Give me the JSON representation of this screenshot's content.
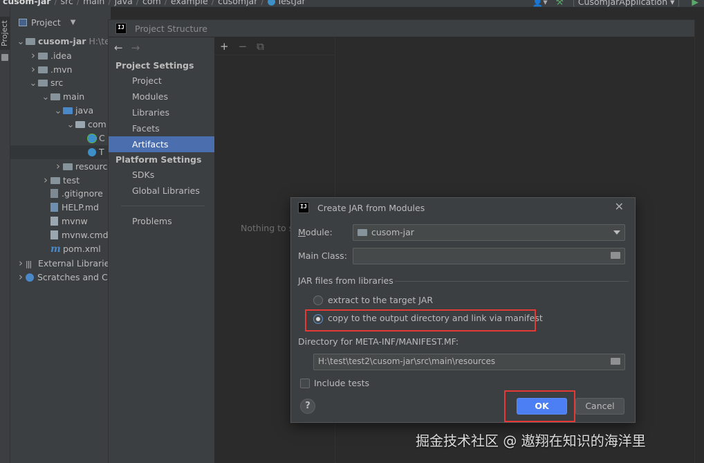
{
  "navbar": {
    "crumbs": [
      "cusom-jar",
      "src",
      "main",
      "java",
      "com",
      "example",
      "cusomjar",
      "TestJar"
    ],
    "run_config": "CusomJarApplication"
  },
  "tool_stripe": {
    "project_tab": "Project"
  },
  "project_panel": {
    "title": "Project",
    "tree": [
      {
        "label": "cusom-jar",
        "extra": "H:\\tes",
        "arrow": "down",
        "indent": 0,
        "icon": "folder",
        "bold": true
      },
      {
        "label": ".idea",
        "arrow": "right",
        "indent": 1,
        "icon": "folder"
      },
      {
        "label": ".mvn",
        "arrow": "right",
        "indent": 1,
        "icon": "folder"
      },
      {
        "label": "src",
        "arrow": "down",
        "indent": 1,
        "icon": "folder"
      },
      {
        "label": "main",
        "arrow": "down",
        "indent": 2,
        "icon": "folder"
      },
      {
        "label": "java",
        "arrow": "down",
        "indent": 3,
        "icon": "folder-blue"
      },
      {
        "label": "com",
        "arrow": "down",
        "indent": 4,
        "icon": "package"
      },
      {
        "label": "C",
        "arrow": "",
        "indent": 5,
        "icon": "class-app"
      },
      {
        "label": "T",
        "arrow": "",
        "indent": 5,
        "icon": "class",
        "highlight": true
      },
      {
        "label": "resources",
        "arrow": "right",
        "indent": 3,
        "icon": "folder"
      },
      {
        "label": "test",
        "arrow": "right",
        "indent": 2,
        "icon": "folder"
      },
      {
        "label": ".gitignore",
        "arrow": "",
        "indent": 2,
        "icon": "file-git"
      },
      {
        "label": "HELP.md",
        "arrow": "",
        "indent": 2,
        "icon": "file-md"
      },
      {
        "label": "mvnw",
        "arrow": "",
        "indent": 2,
        "icon": "file"
      },
      {
        "label": "mvnw.cmd",
        "arrow": "",
        "indent": 2,
        "icon": "file"
      },
      {
        "label": "pom.xml",
        "arrow": "",
        "indent": 2,
        "icon": "maven"
      },
      {
        "label": "External Libraries",
        "arrow": "right",
        "indent": 0,
        "icon": "libs"
      },
      {
        "label": "Scratches and Co",
        "arrow": "right",
        "indent": 0,
        "icon": "scratches"
      }
    ]
  },
  "project_structure": {
    "window_title": "Project Structure",
    "project_settings_header": "Project Settings",
    "project_settings_items": [
      "Project",
      "Modules",
      "Libraries",
      "Facets",
      "Artifacts"
    ],
    "selected_item": "Artifacts",
    "platform_settings_header": "Platform Settings",
    "platform_settings_items": [
      "SDKs",
      "Global Libraries"
    ],
    "problems": "Problems",
    "empty_text": "Nothing to s"
  },
  "dialog": {
    "title": "Create JAR from Modules",
    "module_label": "Module:",
    "module_value": "cusom-jar",
    "main_class_label": "Main Class:",
    "main_class_value": "",
    "jar_section": "JAR files from libraries",
    "option_extract": "extract to the target JAR",
    "option_copy": "copy to the output directory and link via manifest",
    "selected_option": "copy",
    "manifest_dir_label": "Directory for META-INF/MANIFEST.MF:",
    "manifest_dir_value": "H:\\test\\test2\\cusom-jar\\src\\main\\resources",
    "include_tests_label": "Include tests",
    "include_tests_checked": false,
    "ok_label": "OK",
    "cancel_label": "Cancel"
  },
  "watermark": "掘金技术社区 @ 遨翔在知识的海洋里",
  "colors": {
    "accent_blue": "#4b6eaf",
    "ok_button": "#4d7ff4",
    "highlight_box": "#e53935"
  }
}
